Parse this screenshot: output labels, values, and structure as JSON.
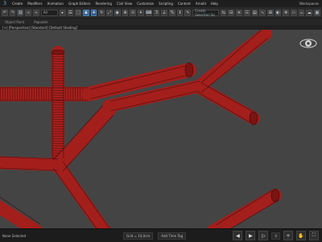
{
  "app": {
    "logo": "3"
  },
  "menu": {
    "items": [
      "Create",
      "Modifiers",
      "Animation",
      "Graph Editors",
      "Rendering",
      "Civil View",
      "Customize",
      "Scripting",
      "Content",
      "Arnold",
      "Help"
    ],
    "workspace": "Workspaces"
  },
  "toolbar": {
    "selection_filter": "All",
    "named_selection": "Create Selection Se"
  },
  "ribbon": {
    "tabs": [
      "Object Paint",
      "Populate"
    ]
  },
  "viewport": {
    "label": "[+] [Perspective] [Standard] [Default Shading]",
    "tube_color": "#a31f1c",
    "background": "#444444"
  },
  "status": {
    "selection_text": "None Selected",
    "grid": "Grid = 10,0cm",
    "add_time_tag": "Add Time Tag",
    "frame": "0"
  }
}
